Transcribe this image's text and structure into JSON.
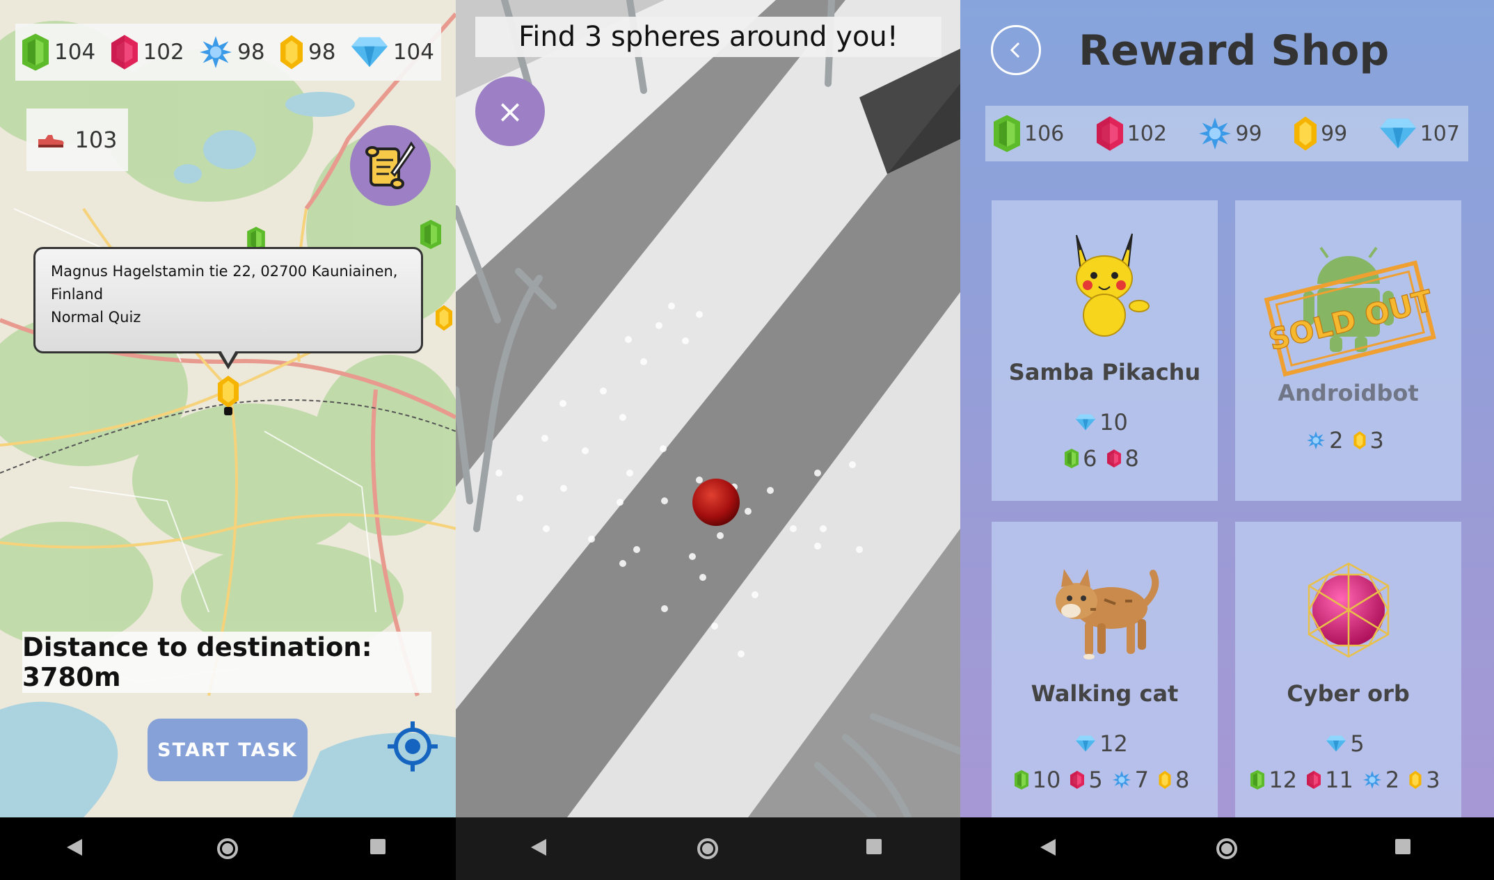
{
  "map_screen": {
    "gems": [
      {
        "icon": "green-gem-icon",
        "value": "104"
      },
      {
        "icon": "red-gem-icon",
        "value": "102"
      },
      {
        "icon": "blue-star-gem-icon",
        "value": "98"
      },
      {
        "icon": "yellow-gem-icon",
        "value": "98"
      },
      {
        "icon": "diamond-icon",
        "value": "104"
      }
    ],
    "steps": "103",
    "callout": {
      "address_line1": "Magnus Hagelstamin tie 22, 02700 Kauniainen,",
      "address_line2": "Finland",
      "task_type": "Normal Quiz"
    },
    "distance": "Distance to destination: 3780m",
    "start_button": "START TASK"
  },
  "ar_screen": {
    "instruction": "Find 3 spheres around you!",
    "close_label": "×"
  },
  "shop_screen": {
    "title": "Reward Shop",
    "gems": [
      {
        "icon": "green-gem-icon",
        "value": "106"
      },
      {
        "icon": "red-gem-icon",
        "value": "102"
      },
      {
        "icon": "blue-star-gem-icon",
        "value": "99"
      },
      {
        "icon": "yellow-gem-icon",
        "value": "99"
      },
      {
        "icon": "diamond-icon",
        "value": "107"
      }
    ],
    "items": [
      {
        "name": "Samba Pikachu",
        "diamond": "10",
        "costs": [
          "6",
          "8"
        ]
      },
      {
        "name": "Androidbot",
        "sold_out": "SOLD OUT",
        "costs": [
          "2",
          "3"
        ]
      },
      {
        "name": "Walking cat",
        "diamond": "12",
        "costs": [
          "10",
          "5",
          "7",
          "8"
        ]
      },
      {
        "name": "Cyber orb",
        "diamond": "5",
        "costs": [
          "12",
          "11",
          "2",
          "3"
        ]
      }
    ]
  },
  "colors": {
    "accent_purple": "#9c7fc4",
    "button_blue": "#86a0d8",
    "locate_blue": "#1565c0"
  }
}
